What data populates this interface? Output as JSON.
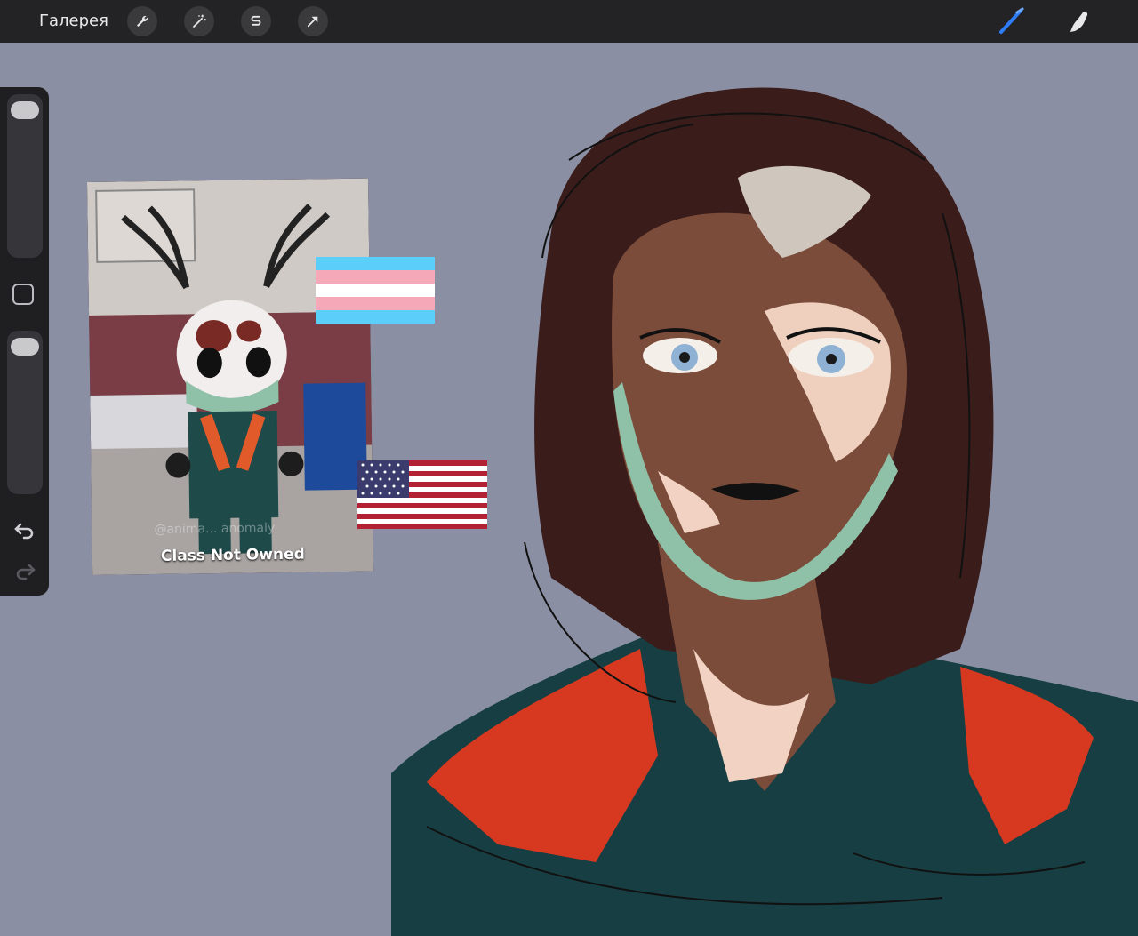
{
  "topbar": {
    "gallery_label": "Галерея",
    "buttons": [
      "wrench-icon",
      "magic-wand-icon",
      "selection-icon",
      "transform-arrow-icon"
    ],
    "tools": [
      "brush-icon",
      "smudge-icon"
    ]
  },
  "sidebar": {
    "buttons": [
      "brush-size-slider",
      "modify-button",
      "opacity-slider",
      "undo-icon",
      "redo-icon"
    ]
  },
  "reference_image": {
    "caption": "Class Not Owned",
    "watermark": "@anima... anomaly"
  },
  "colors": {
    "canvas": "#8a8fa3",
    "topbar": "#232325",
    "accent_brush": "#2e7cf6"
  }
}
